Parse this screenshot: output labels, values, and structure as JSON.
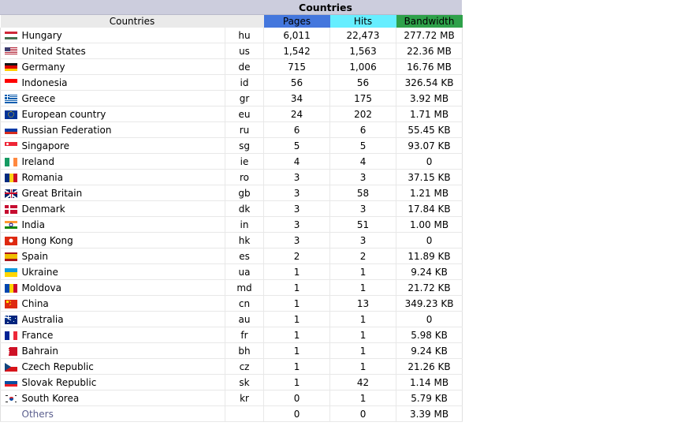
{
  "panel": {
    "title": "Countries"
  },
  "table": {
    "headers": {
      "countries": "Countries",
      "pages": "Pages",
      "hits": "Hits",
      "bandwidth": "Bandwidth"
    },
    "header_colors": {
      "countries": "#eaeaea",
      "pages": "#4477dd",
      "hits": "#66eeff",
      "bandwidth": "#2ea14a"
    },
    "rows": [
      {
        "flag": "hungary-flag",
        "country": "Hungary",
        "code": "hu",
        "pages": "6,011",
        "hits": "22,473",
        "bandwidth": "277.72 MB"
      },
      {
        "flag": "united-states-flag",
        "country": "United States",
        "code": "us",
        "pages": "1,542",
        "hits": "1,563",
        "bandwidth": "22.36 MB"
      },
      {
        "flag": "germany-flag",
        "country": "Germany",
        "code": "de",
        "pages": "715",
        "hits": "1,006",
        "bandwidth": "16.76 MB"
      },
      {
        "flag": "indonesia-flag",
        "country": "Indonesia",
        "code": "id",
        "pages": "56",
        "hits": "56",
        "bandwidth": "326.54 KB"
      },
      {
        "flag": "greece-flag",
        "country": "Greece",
        "code": "gr",
        "pages": "34",
        "hits": "175",
        "bandwidth": "3.92 MB"
      },
      {
        "flag": "european-union-flag",
        "country": "European country",
        "code": "eu",
        "pages": "24",
        "hits": "202",
        "bandwidth": "1.71 MB"
      },
      {
        "flag": "russia-flag",
        "country": "Russian Federation",
        "code": "ru",
        "pages": "6",
        "hits": "6",
        "bandwidth": "55.45 KB"
      },
      {
        "flag": "singapore-flag",
        "country": "Singapore",
        "code": "sg",
        "pages": "5",
        "hits": "5",
        "bandwidth": "93.07 KB"
      },
      {
        "flag": "ireland-flag",
        "country": "Ireland",
        "code": "ie",
        "pages": "4",
        "hits": "4",
        "bandwidth": "0"
      },
      {
        "flag": "romania-flag",
        "country": "Romania",
        "code": "ro",
        "pages": "3",
        "hits": "3",
        "bandwidth": "37.15 KB"
      },
      {
        "flag": "great-britain-flag",
        "country": "Great Britain",
        "code": "gb",
        "pages": "3",
        "hits": "58",
        "bandwidth": "1.21 MB"
      },
      {
        "flag": "denmark-flag",
        "country": "Denmark",
        "code": "dk",
        "pages": "3",
        "hits": "3",
        "bandwidth": "17.84 KB"
      },
      {
        "flag": "india-flag",
        "country": "India",
        "code": "in",
        "pages": "3",
        "hits": "51",
        "bandwidth": "1.00 MB"
      },
      {
        "flag": "hong-kong-flag",
        "country": "Hong Kong",
        "code": "hk",
        "pages": "3",
        "hits": "3",
        "bandwidth": "0"
      },
      {
        "flag": "spain-flag",
        "country": "Spain",
        "code": "es",
        "pages": "2",
        "hits": "2",
        "bandwidth": "11.89 KB"
      },
      {
        "flag": "ukraine-flag",
        "country": "Ukraine",
        "code": "ua",
        "pages": "1",
        "hits": "1",
        "bandwidth": "9.24 KB"
      },
      {
        "flag": "moldova-flag",
        "country": "Moldova",
        "code": "md",
        "pages": "1",
        "hits": "1",
        "bandwidth": "21.72 KB"
      },
      {
        "flag": "china-flag",
        "country": "China",
        "code": "cn",
        "pages": "1",
        "hits": "13",
        "bandwidth": "349.23 KB"
      },
      {
        "flag": "australia-flag",
        "country": "Australia",
        "code": "au",
        "pages": "1",
        "hits": "1",
        "bandwidth": "0"
      },
      {
        "flag": "france-flag",
        "country": "France",
        "code": "fr",
        "pages": "1",
        "hits": "1",
        "bandwidth": "5.98 KB"
      },
      {
        "flag": "bahrain-flag",
        "country": "Bahrain",
        "code": "bh",
        "pages": "1",
        "hits": "1",
        "bandwidth": "9.24 KB"
      },
      {
        "flag": "czech-republic-flag",
        "country": "Czech Republic",
        "code": "cz",
        "pages": "1",
        "hits": "1",
        "bandwidth": "21.26 KB"
      },
      {
        "flag": "slovak-republic-flag",
        "country": "Slovak Republic",
        "code": "sk",
        "pages": "1",
        "hits": "42",
        "bandwidth": "1.14 MB"
      },
      {
        "flag": "south-korea-flag",
        "country": "South Korea",
        "code": "kr",
        "pages": "0",
        "hits": "1",
        "bandwidth": "5.79 KB"
      },
      {
        "flag": "",
        "country": "Others",
        "code": "",
        "pages": "0",
        "hits": "0",
        "bandwidth": "3.39 MB"
      }
    ]
  }
}
